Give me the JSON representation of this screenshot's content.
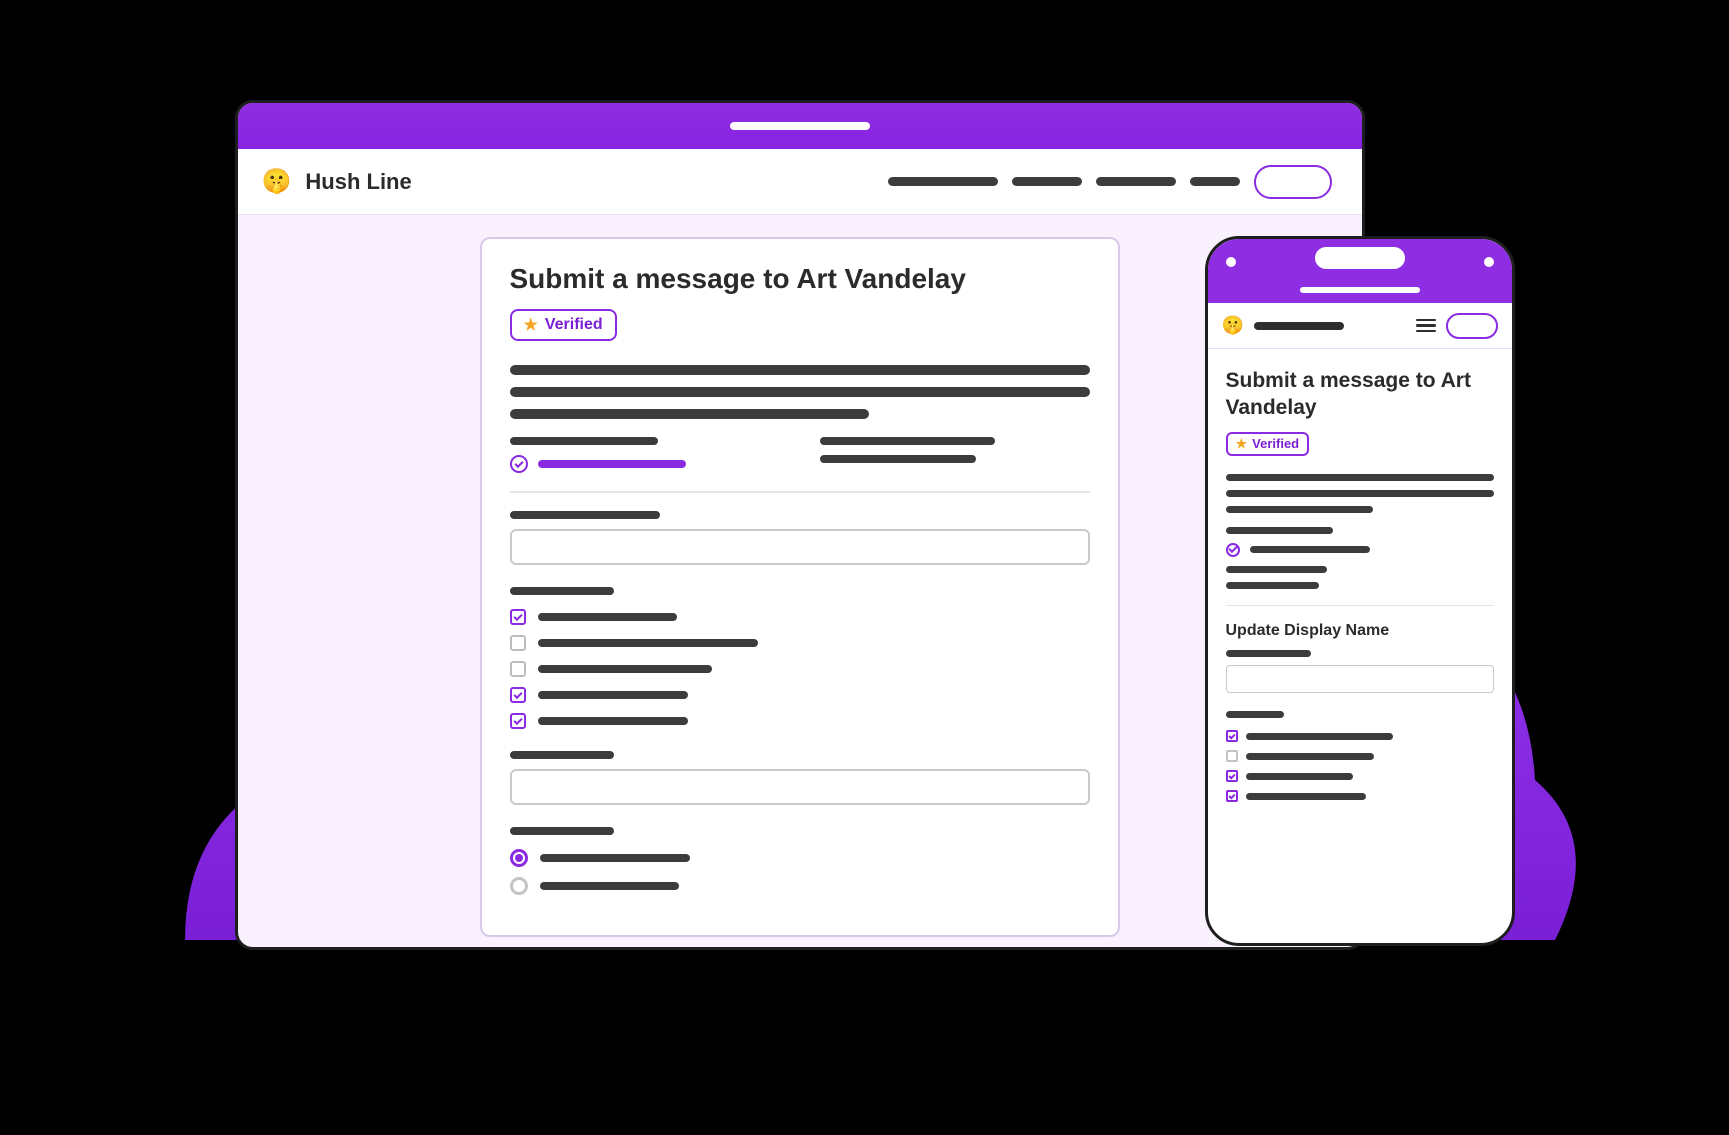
{
  "brand": "Hush Line",
  "colors": {
    "accent": "#8A2BE2",
    "star": "#F5A623"
  },
  "desktop": {
    "title": "Submit a message to Art Vandelay",
    "verified_label": "Verified",
    "checkboxes": [
      {
        "checked": true
      },
      {
        "checked": false
      },
      {
        "checked": false
      },
      {
        "checked": true
      },
      {
        "checked": true
      }
    ],
    "radios": [
      {
        "selected": true
      },
      {
        "selected": false
      }
    ]
  },
  "mobile": {
    "title": "Submit a message to Art Vandelay",
    "verified_label": "Verified",
    "section_label": "Update Display Name",
    "checkboxes": [
      {
        "checked": true
      },
      {
        "checked": false
      },
      {
        "checked": true
      },
      {
        "checked": true
      }
    ]
  }
}
